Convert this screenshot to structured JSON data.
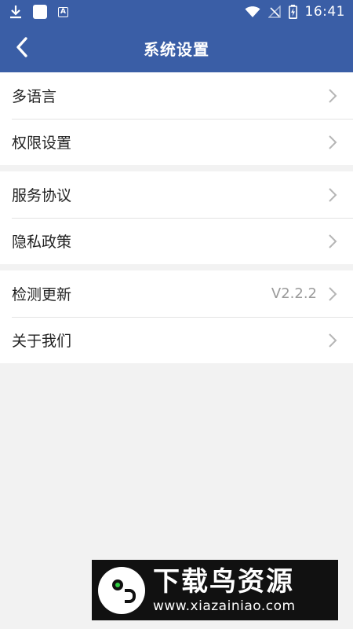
{
  "status_bar": {
    "time": "16:41",
    "left_icons": [
      "download-icon",
      "app-icon",
      "a-icon"
    ],
    "right_icons": [
      "wifi-icon",
      "no-signal-icon",
      "battery-charging-icon"
    ]
  },
  "app_bar": {
    "title": "系统设置",
    "back_icon": "chevron-left-icon",
    "color": "#3a5ea6"
  },
  "groups": [
    {
      "items": [
        {
          "label": "多语言"
        },
        {
          "label": "权限设置"
        }
      ]
    },
    {
      "items": [
        {
          "label": "服务协议"
        },
        {
          "label": "隐私政策"
        }
      ]
    },
    {
      "items": [
        {
          "label": "检测更新",
          "value": "V2.2.2"
        },
        {
          "label": "关于我们"
        }
      ]
    }
  ],
  "watermark": {
    "title": "下载鸟资源",
    "url": "www.xiazainiao.com"
  }
}
